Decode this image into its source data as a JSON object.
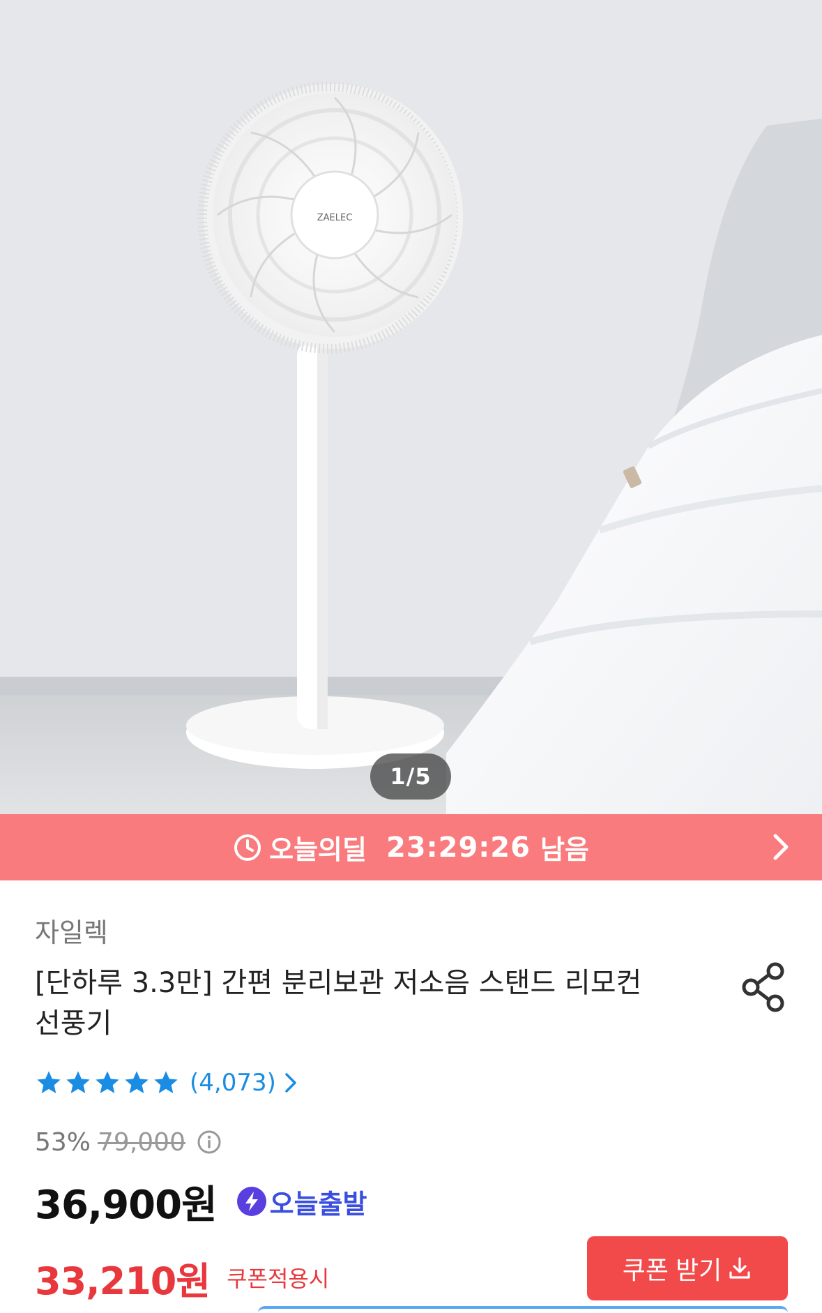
{
  "gallery": {
    "fan_logo_text": "ZAELEC",
    "pager": "1/5"
  },
  "deal": {
    "label": "오늘의딜",
    "countdown": "23:29:26",
    "suffix": "남음",
    "color": "#f97b7d"
  },
  "product": {
    "brand": "자일렉",
    "title": "[단하루 3.3만] 간편 분리보관 저소음 스탠드 리모컨 선풍기",
    "rating": {
      "stars": 5,
      "review_count": "(4,073)"
    },
    "discount_rate": "53%",
    "original_price": "79,000",
    "price": "36,900원",
    "shipping_badge": "오늘출발",
    "coupon_price": "33,210원",
    "coupon_note": "쿠폰적용시",
    "coupon_button": "쿠폰 받기"
  },
  "colors": {
    "accent_red": "#e8383d",
    "star_blue": "#1a8ce3",
    "shipping_purple": "#3a4fe0"
  }
}
